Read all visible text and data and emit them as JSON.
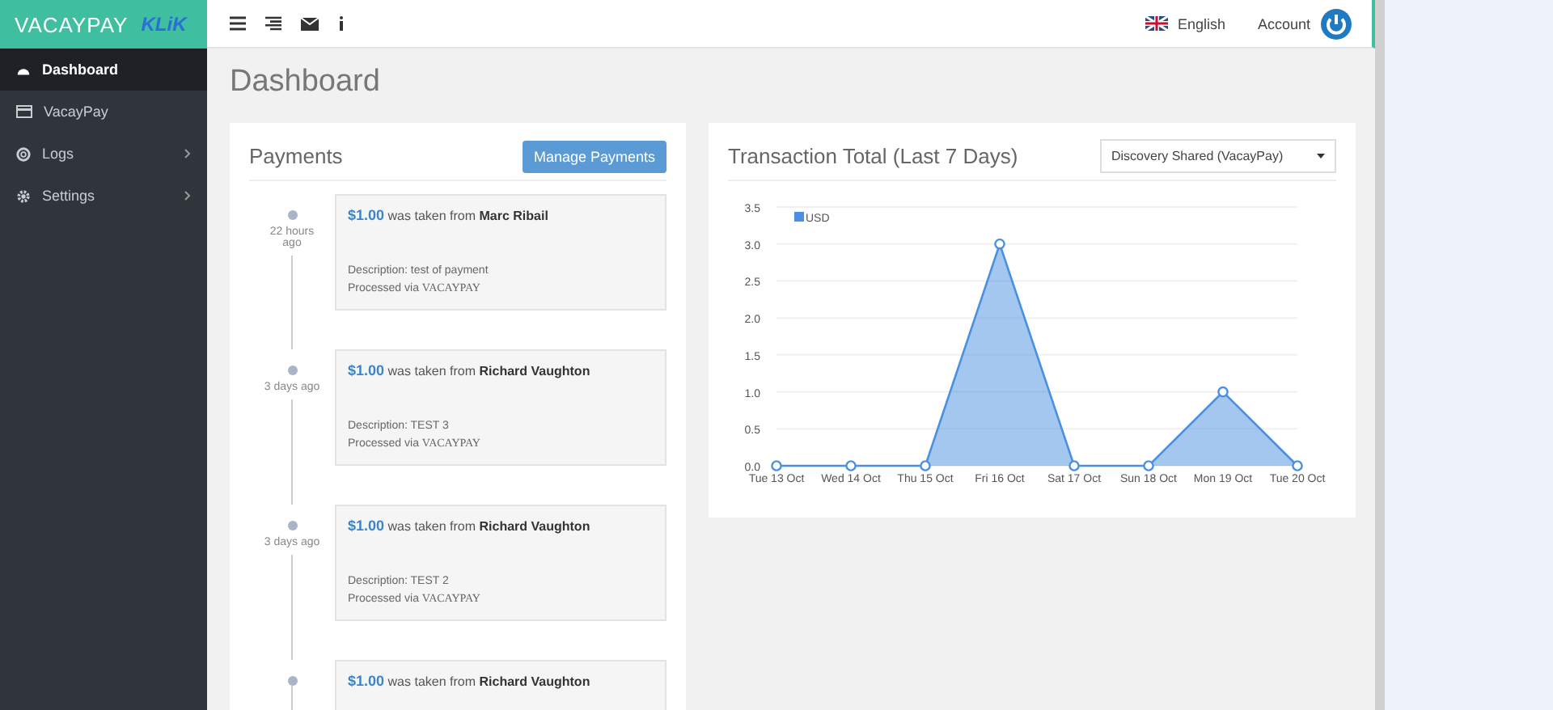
{
  "brand": {
    "name": "VACAYPAY",
    "partner": "KLiK"
  },
  "sidebar": {
    "items": [
      {
        "label": "Dashboard",
        "selected": true,
        "has_submenu": false
      },
      {
        "label": "VacayPay",
        "selected": false,
        "has_submenu": false
      },
      {
        "label": "Logs",
        "selected": false,
        "has_submenu": true
      },
      {
        "label": "Settings",
        "selected": false,
        "has_submenu": true
      }
    ]
  },
  "topbar": {
    "language": "English",
    "account": "Account"
  },
  "page_title": "Dashboard",
  "payments": {
    "title": "Payments",
    "button": "Manage Payments",
    "entries": [
      {
        "time": "22 hours ago",
        "amount": "$1.00",
        "text": "was taken from",
        "payer": "Marc Ribail",
        "description": "Description: test of payment",
        "processed": "Processed via",
        "processor": "VACAYPAY"
      },
      {
        "time": "3 days ago",
        "amount": "$1.00",
        "text": "was taken from",
        "payer": "Richard Vaughton",
        "description": "Description: TEST 3",
        "processed": "Processed via",
        "processor": "VACAYPAY"
      },
      {
        "time": "3 days ago",
        "amount": "$1.00",
        "text": "was taken from",
        "payer": "Richard Vaughton",
        "description": "Description: TEST 2",
        "processed": "Processed via",
        "processor": "VACAYPAY"
      },
      {
        "amount": "$1.00",
        "text": "was taken from",
        "payer": "Richard Vaughton"
      }
    ]
  },
  "transactions": {
    "title": "Transaction Total (Last 7 Days)",
    "account_select": "Discovery Shared (VacayPay)",
    "chart_data": {
      "type": "area",
      "categories": [
        "Tue 13 Oct",
        "Wed 14 Oct",
        "Thu 15 Oct",
        "Fri 16 Oct",
        "Sat 17 Oct",
        "Sun 18 Oct",
        "Mon 19 Oct",
        "Tue 20 Oct"
      ],
      "grid": true,
      "series": [
        {
          "name": "USD",
          "color": "#4a90e2",
          "values": [
            0,
            0,
            0,
            3,
            0,
            0,
            1,
            0
          ]
        }
      ],
      "ylim": [
        0,
        3.5
      ],
      "yticks": [
        {
          "value": 0,
          "label": "0.0"
        },
        {
          "value": 0.5,
          "label": "0.5"
        },
        {
          "value": 1,
          "label": "1.0"
        },
        {
          "value": 1.5,
          "label": "1.5"
        },
        {
          "value": 2,
          "label": "2.0"
        },
        {
          "value": 2.5,
          "label": "2.5"
        },
        {
          "value": 3,
          "label": "3.0"
        },
        {
          "value": 3.5,
          "label": "3.5"
        }
      ]
    }
  }
}
